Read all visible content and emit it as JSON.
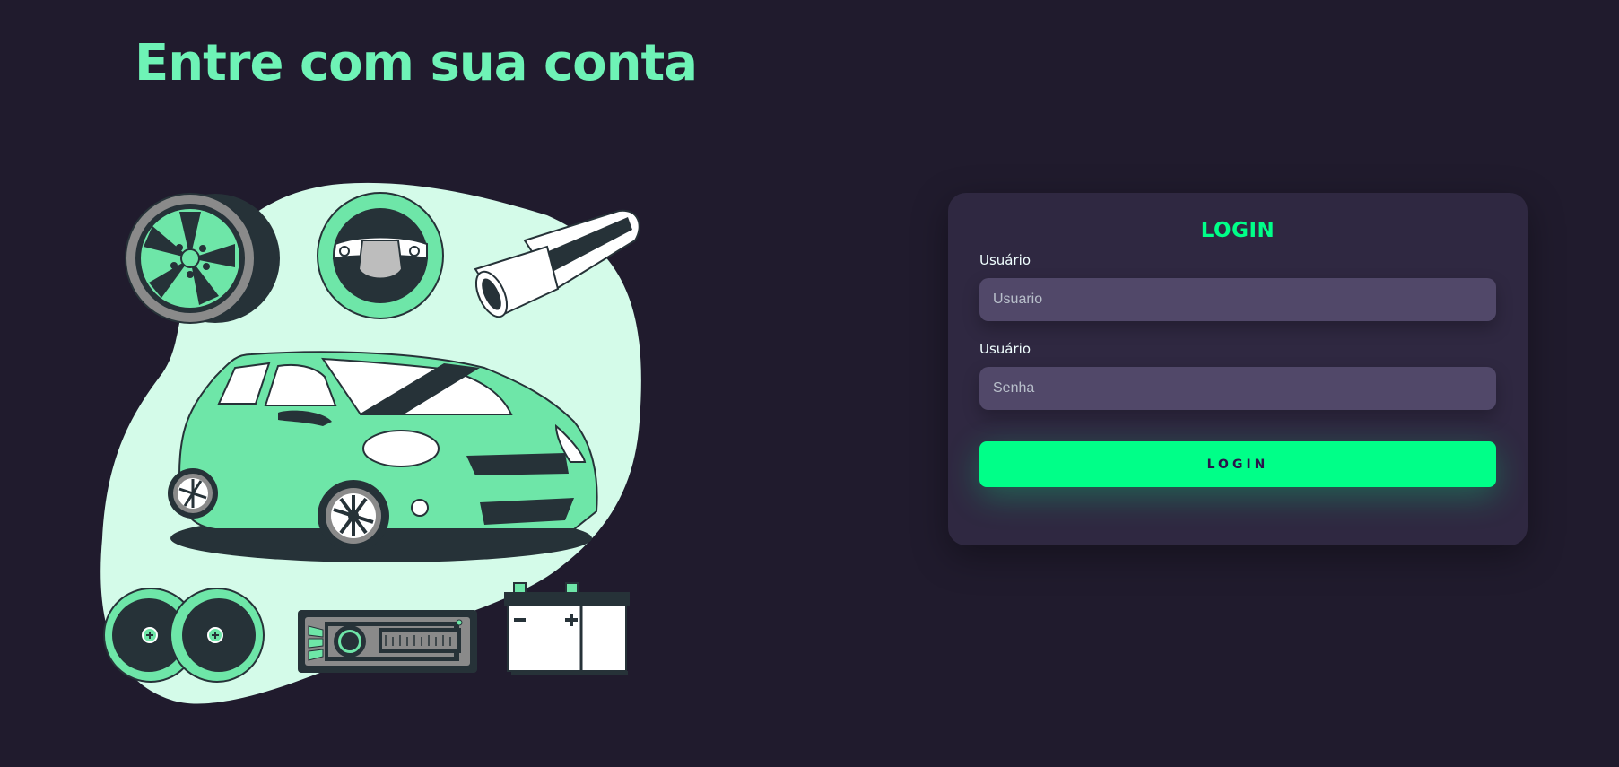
{
  "header": {
    "title": "Entre com sua conta"
  },
  "login": {
    "title": "LOGIN",
    "username_label": "Usuário",
    "username_placeholder": "Usuario",
    "password_label": "Usuário",
    "password_placeholder": "Senha",
    "submit_label": "LOGIN"
  },
  "illustration": {
    "items": [
      "wheel-icon",
      "steering-wheel-icon",
      "exhaust-pipe-icon",
      "car-icon",
      "speakers-icon",
      "car-radio-icon",
      "battery-icon"
    ]
  },
  "colors": {
    "background": "#201b2d",
    "card": "#2f2841",
    "input": "#514869",
    "accent": "#00ff88",
    "title": "#6ef3b6",
    "blob": "#d4fbe9",
    "dark": "#263238"
  }
}
